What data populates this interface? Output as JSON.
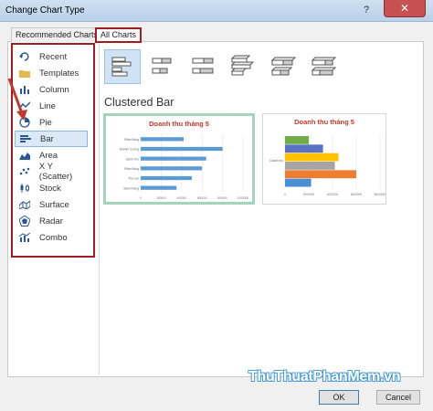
{
  "window": {
    "title": "Change Chart Type",
    "help": "?",
    "close": "✕"
  },
  "tabs": [
    {
      "label": "Recommended Charts"
    },
    {
      "label": "All Charts"
    }
  ],
  "sidebar": {
    "items": [
      {
        "label": "Recent",
        "icon": "recent-icon"
      },
      {
        "label": "Templates",
        "icon": "folder-icon"
      },
      {
        "label": "Column",
        "icon": "column-chart-icon"
      },
      {
        "label": "Line",
        "icon": "line-chart-icon"
      },
      {
        "label": "Pie",
        "icon": "pie-chart-icon"
      },
      {
        "label": "Bar",
        "icon": "bar-chart-icon",
        "selected": true
      },
      {
        "label": "Area",
        "icon": "area-chart-icon"
      },
      {
        "label": "X Y (Scatter)",
        "icon": "scatter-chart-icon"
      },
      {
        "label": "Stock",
        "icon": "stock-chart-icon"
      },
      {
        "label": "Surface",
        "icon": "surface-chart-icon"
      },
      {
        "label": "Radar",
        "icon": "radar-chart-icon"
      },
      {
        "label": "Combo",
        "icon": "combo-chart-icon"
      }
    ]
  },
  "subtypes": {
    "items": [
      {
        "icon": "clustered-bar-icon",
        "selected": true
      },
      {
        "icon": "stacked-bar-icon"
      },
      {
        "icon": "100-stacked-bar-icon"
      },
      {
        "icon": "3d-clustered-bar-icon"
      },
      {
        "icon": "3d-stacked-bar-icon"
      },
      {
        "icon": "3d-100-stacked-bar-icon"
      }
    ]
  },
  "main": {
    "heading": "Clustered Bar"
  },
  "previews": {
    "p1": {
      "title": "Doanh thu tháng 5"
    },
    "p2": {
      "title": "Doanh thu tháng 5"
    }
  },
  "chart_data": [
    {
      "type": "bar",
      "title": "Doanh thu tháng 5",
      "categories": [
        "Phân Bông",
        "Vitamin Cường",
        "Danh Thu",
        "Phân Bông",
        "Thu Lan",
        "Mạnh Hùng"
      ],
      "values": [
        420,
        800,
        640,
        600,
        500,
        350
      ],
      "x_ticks": [
        "0",
        "200000",
        "400000",
        "600000",
        "800000",
        "1000000"
      ],
      "xlim": [
        0,
        1000
      ]
    },
    {
      "type": "bar",
      "title": "Doanh thu tháng 5",
      "categories": [
        "Doanh thu"
      ],
      "series": [
        {
          "values": [
            2200
          ],
          "color": "#4a8ed4"
        },
        {
          "values": [
            6000
          ],
          "color": "#ed7d31"
        },
        {
          "values": [
            4200
          ],
          "color": "#a5a5a5"
        },
        {
          "values": [
            4500
          ],
          "color": "#ffc000"
        },
        {
          "values": [
            3200
          ],
          "color": "#5b72c4"
        },
        {
          "values": [
            2000
          ],
          "color": "#70ad47"
        }
      ],
      "x_ticks": [
        "0",
        "2000000",
        "4000000",
        "6000000",
        "8000000"
      ],
      "xlim": [
        0,
        8000
      ]
    }
  ],
  "buttons": {
    "ok": "OK",
    "cancel": "Cancel"
  },
  "watermark": {
    "text": "ThuThuatPhanMem",
    "suffix": ".vn"
  }
}
